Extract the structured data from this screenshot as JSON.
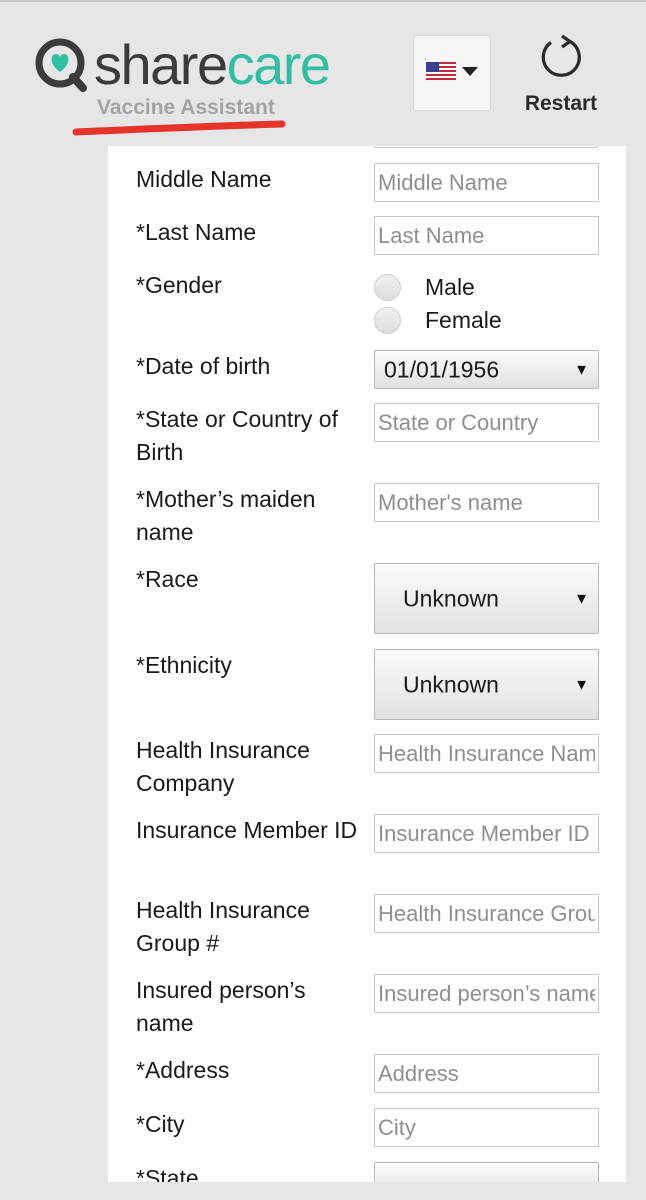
{
  "header": {
    "logo_left": "share",
    "logo_right": "care",
    "subtitle": "Vaccine Assistant",
    "language_flag": "us-flag-icon",
    "restart_label": "Restart"
  },
  "colors": {
    "brand_teal": "#2ebfa5",
    "logo_gray": "#3b3b3b",
    "subtitle_gray": "#a3a3a3",
    "annotation_red": "#e8332a"
  },
  "form": {
    "middle_name": {
      "label": "Middle Name",
      "placeholder": "Middle Name"
    },
    "last_name": {
      "label": "*Last Name",
      "placeholder": "Last Name"
    },
    "gender": {
      "label": "*Gender",
      "options": [
        "Male",
        "Female"
      ]
    },
    "dob": {
      "label": "*Date of birth",
      "value": "01/01/1956"
    },
    "birth_place": {
      "label": "*State or Country of Birth",
      "placeholder": "State or Country"
    },
    "mother_maiden": {
      "label": "*Mother’s maiden name",
      "placeholder": "Mother's name"
    },
    "race": {
      "label": "*Race",
      "value": "Unknown"
    },
    "ethnicity": {
      "label": "*Ethnicity",
      "value": "Unknown"
    },
    "insurance_company": {
      "label": "Health Insurance Company",
      "placeholder": "Health Insurance Name"
    },
    "member_id": {
      "label": "Insurance Member ID",
      "placeholder": "Insurance Member ID"
    },
    "group_number": {
      "label": "Health Insurance Group #",
      "placeholder": "Health Insurance Group"
    },
    "insured_name": {
      "label": "Insured person’s name",
      "placeholder": "Insured person’s name"
    },
    "address": {
      "label": "*Address",
      "placeholder": "Address"
    },
    "city": {
      "label": "*City",
      "placeholder": "City"
    },
    "state": {
      "label": "*State"
    }
  }
}
